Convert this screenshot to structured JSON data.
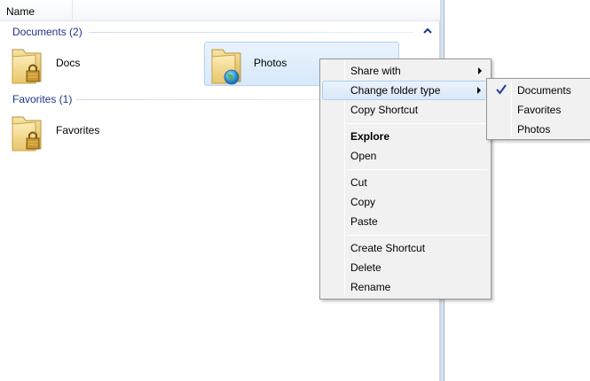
{
  "window": {
    "column_header": "Name"
  },
  "groups": [
    {
      "title": "Documents (2)",
      "items": [
        {
          "label": "Docs",
          "icon": "locked-folder-icon"
        },
        {
          "label": "Photos",
          "icon": "shared-folder-icon",
          "selected": true
        }
      ]
    },
    {
      "title": "Favorites (1)",
      "items": [
        {
          "label": "Favorites",
          "icon": "locked-folder-icon"
        }
      ]
    }
  ],
  "context_menu": {
    "share_with": "Share with",
    "change_folder_type": "Change folder type",
    "copy_shortcut": "Copy Shortcut",
    "explore": "Explore",
    "open": "Open",
    "cut": "Cut",
    "copy": "Copy",
    "paste": "Paste",
    "create_shortcut": "Create Shortcut",
    "delete": "Delete",
    "rename": "Rename"
  },
  "submenu": {
    "items": [
      {
        "label": "Documents",
        "checked": true
      },
      {
        "label": "Favorites",
        "checked": false
      },
      {
        "label": "Photos",
        "checked": false
      }
    ]
  },
  "colors": {
    "group_title": "#1e3287",
    "selection_fill": "#d7e9fb",
    "selection_border": "#b5d3f2",
    "menu_background": "#f1f1f1",
    "check_mark": "#1f3fa0"
  }
}
